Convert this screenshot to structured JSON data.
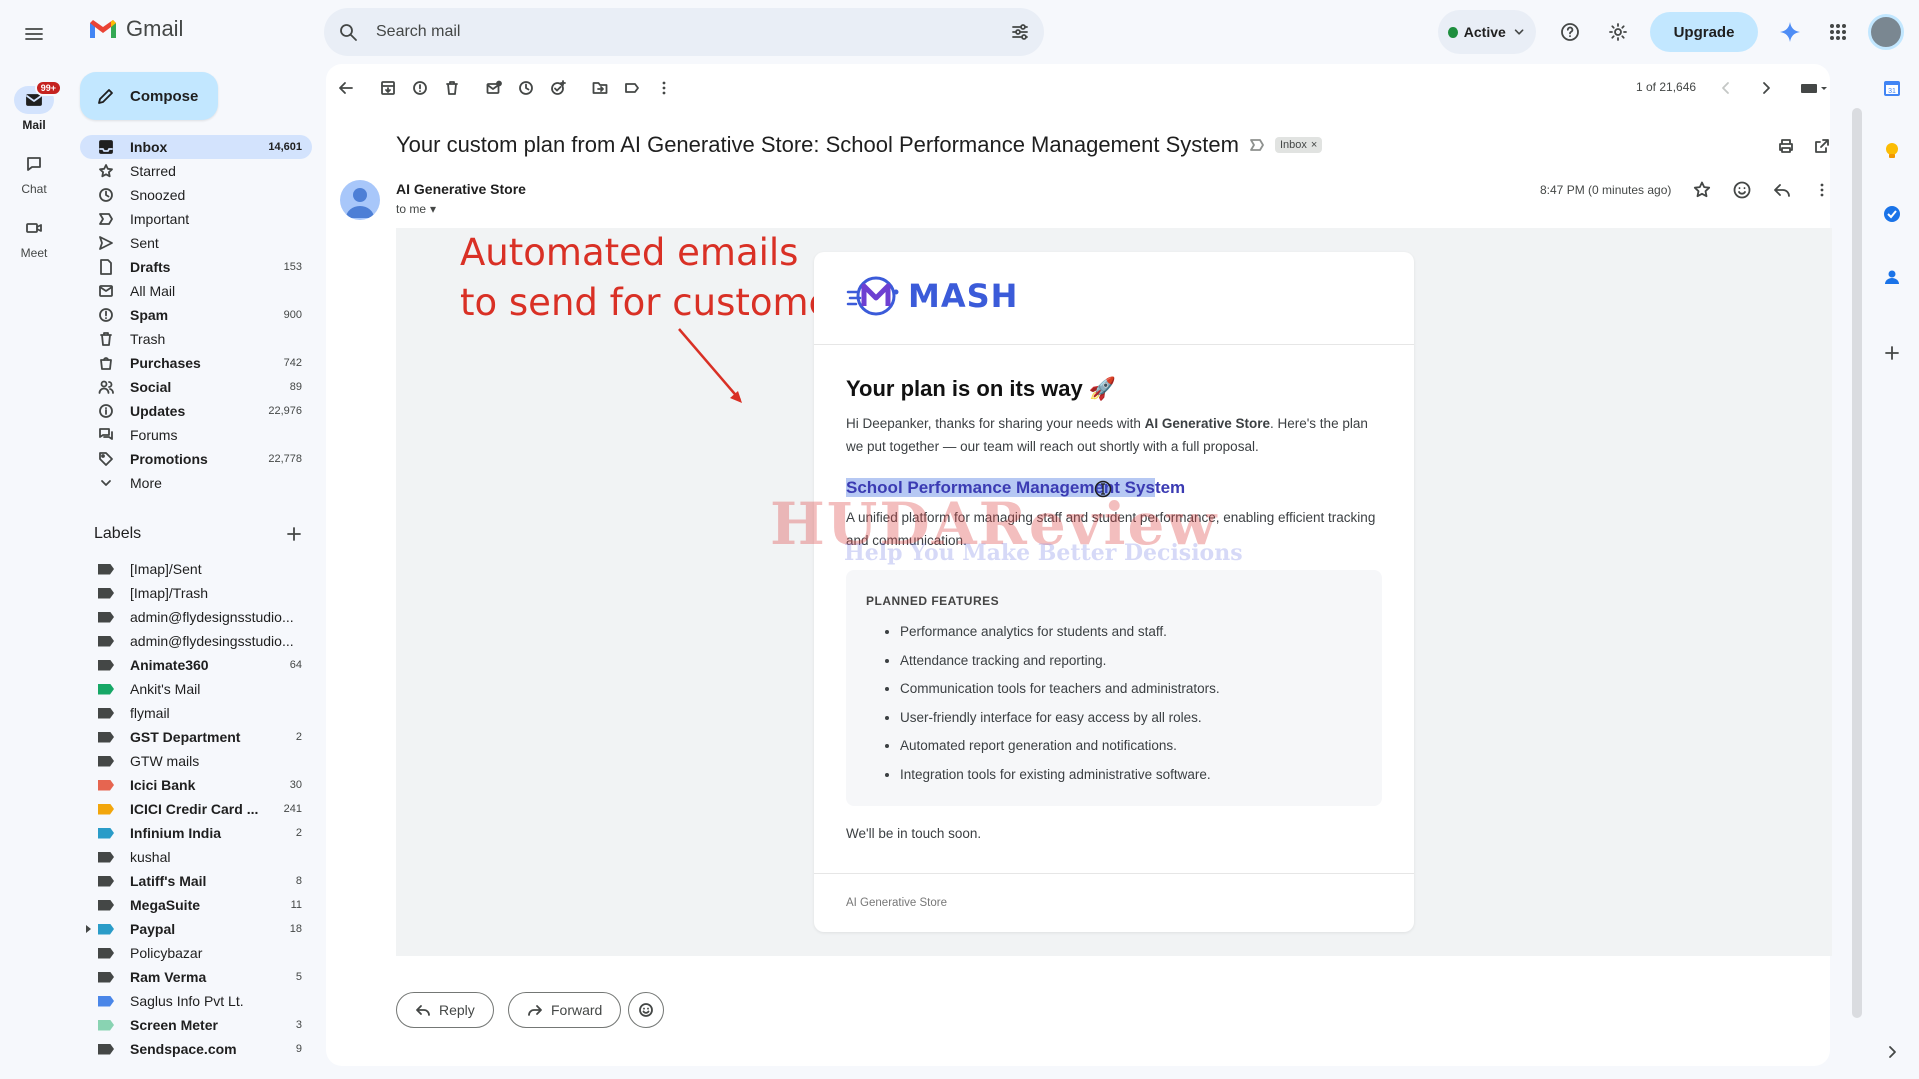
{
  "app": {
    "name": "Gmail"
  },
  "rail": {
    "mail_label": "Mail",
    "mail_badge": "99+",
    "chat_label": "Chat",
    "meet_label": "Meet"
  },
  "search": {
    "placeholder": "Search mail"
  },
  "status": {
    "label": "Active",
    "color": "#1e8e3e"
  },
  "header": {
    "upgrade_label": "Upgrade"
  },
  "compose": {
    "label": "Compose"
  },
  "nav": [
    {
      "label": "Inbox",
      "count": "14,601",
      "icon": "inbox-icon"
    },
    {
      "label": "Starred",
      "count": "",
      "icon": "star-icon"
    },
    {
      "label": "Snoozed",
      "count": "",
      "icon": "clock-icon"
    },
    {
      "label": "Important",
      "count": "",
      "icon": "important-icon"
    },
    {
      "label": "Sent",
      "count": "",
      "icon": "send-icon"
    },
    {
      "label": "Drafts",
      "count": "153",
      "icon": "draft-icon"
    },
    {
      "label": "All Mail",
      "count": "",
      "icon": "all-mail-icon"
    },
    {
      "label": "Spam",
      "count": "900",
      "icon": "spam-icon"
    },
    {
      "label": "Trash",
      "count": "",
      "icon": "trash-icon"
    },
    {
      "label": "Purchases",
      "count": "742",
      "icon": "purchases-icon"
    },
    {
      "label": "Social",
      "count": "89",
      "icon": "social-icon"
    },
    {
      "label": "Updates",
      "count": "22,976",
      "icon": "updates-icon"
    },
    {
      "label": "Forums",
      "count": "",
      "icon": "forums-icon"
    },
    {
      "label": "Promotions",
      "count": "22,778",
      "icon": "tag-icon"
    },
    {
      "label": "More",
      "count": "",
      "icon": "chevron-down-icon"
    }
  ],
  "labels_title": "Labels",
  "labels": [
    {
      "label": "[Imap]/Sent",
      "count": "",
      "color": "#444746"
    },
    {
      "label": "[Imap]/Trash",
      "count": "",
      "color": "#444746"
    },
    {
      "label": "admin@flydesignsstudio...",
      "count": "",
      "color": "#444746"
    },
    {
      "label": "admin@flydesingsstudio...",
      "count": "",
      "color": "#444746"
    },
    {
      "label": "Animate360",
      "count": "64",
      "color": "#444746"
    },
    {
      "label": "Ankit's Mail",
      "count": "",
      "color": "#16a766"
    },
    {
      "label": "flymail",
      "count": "",
      "color": "#444746"
    },
    {
      "label": "GST Department",
      "count": "2",
      "color": "#444746"
    },
    {
      "label": "GTW mails",
      "count": "",
      "color": "#444746"
    },
    {
      "label": "Icici Bank",
      "count": "30",
      "color": "#e66550"
    },
    {
      "label": "ICICI Credir Card ...",
      "count": "241",
      "color": "#f2a60c"
    },
    {
      "label": "Infinium India",
      "count": "2",
      "color": "#2a9cc8"
    },
    {
      "label": "kushal",
      "count": "",
      "color": "#444746"
    },
    {
      "label": "Latiff's Mail",
      "count": "8",
      "color": "#444746"
    },
    {
      "label": "MegaSuite",
      "count": "11",
      "color": "#444746"
    },
    {
      "label": "Paypal",
      "count": "18",
      "color": "#2a9cc8"
    },
    {
      "label": "Policybazar",
      "count": "",
      "color": "#444746"
    },
    {
      "label": "Ram Verma",
      "count": "5",
      "color": "#444746"
    },
    {
      "label": "Saglus Info Pvt Lt.",
      "count": "",
      "color": "#4a86e8"
    },
    {
      "label": "Screen Meter",
      "count": "3",
      "color": "#89d3b2"
    },
    {
      "label": "Sendspace.com",
      "count": "9",
      "color": "#444746"
    }
  ],
  "toolbar": {
    "page_count": "1 of 21,646"
  },
  "email": {
    "subject": "Your custom plan from AI Generative Store: School Performance Management System",
    "inbox_chip": "Inbox",
    "sender": "AI Generative Store",
    "to": "to me",
    "time": "8:47 PM (0 minutes ago)"
  },
  "annotation": {
    "line1": "Automated emails",
    "line2": "to send for customers"
  },
  "body": {
    "brand": "MASH",
    "title": "Your plan is on its way 🚀",
    "intro_pre": "Hi Deepanker, thanks for sharing your needs with ",
    "intro_bold": "AI Generative Store",
    "intro_post": ". Here's the plan we put together — our team will reach out shortly with a full proposal.",
    "system_name_highlighted": "School Performance Management Sys",
    "system_name_rest": "tem",
    "system_desc": "A unified platform for managing staff and student performance, enabling efficient tracking and communication.",
    "features_title": "PLANNED FEATURES",
    "features": [
      "Performance analytics for students and staff.",
      "Attendance tracking and reporting.",
      "Communication tools for teachers and administrators.",
      "User-friendly interface for easy access by all roles.",
      "Automated report generation and notifications.",
      "Integration tools for existing administrative software."
    ],
    "closing": "We'll be in touch soon.",
    "footer": "AI Generative Store"
  },
  "watermark": {
    "big": "HUDAReview",
    "small": "Help You Make Better Decisions"
  },
  "actions": {
    "reply": "Reply",
    "forward": "Forward"
  }
}
